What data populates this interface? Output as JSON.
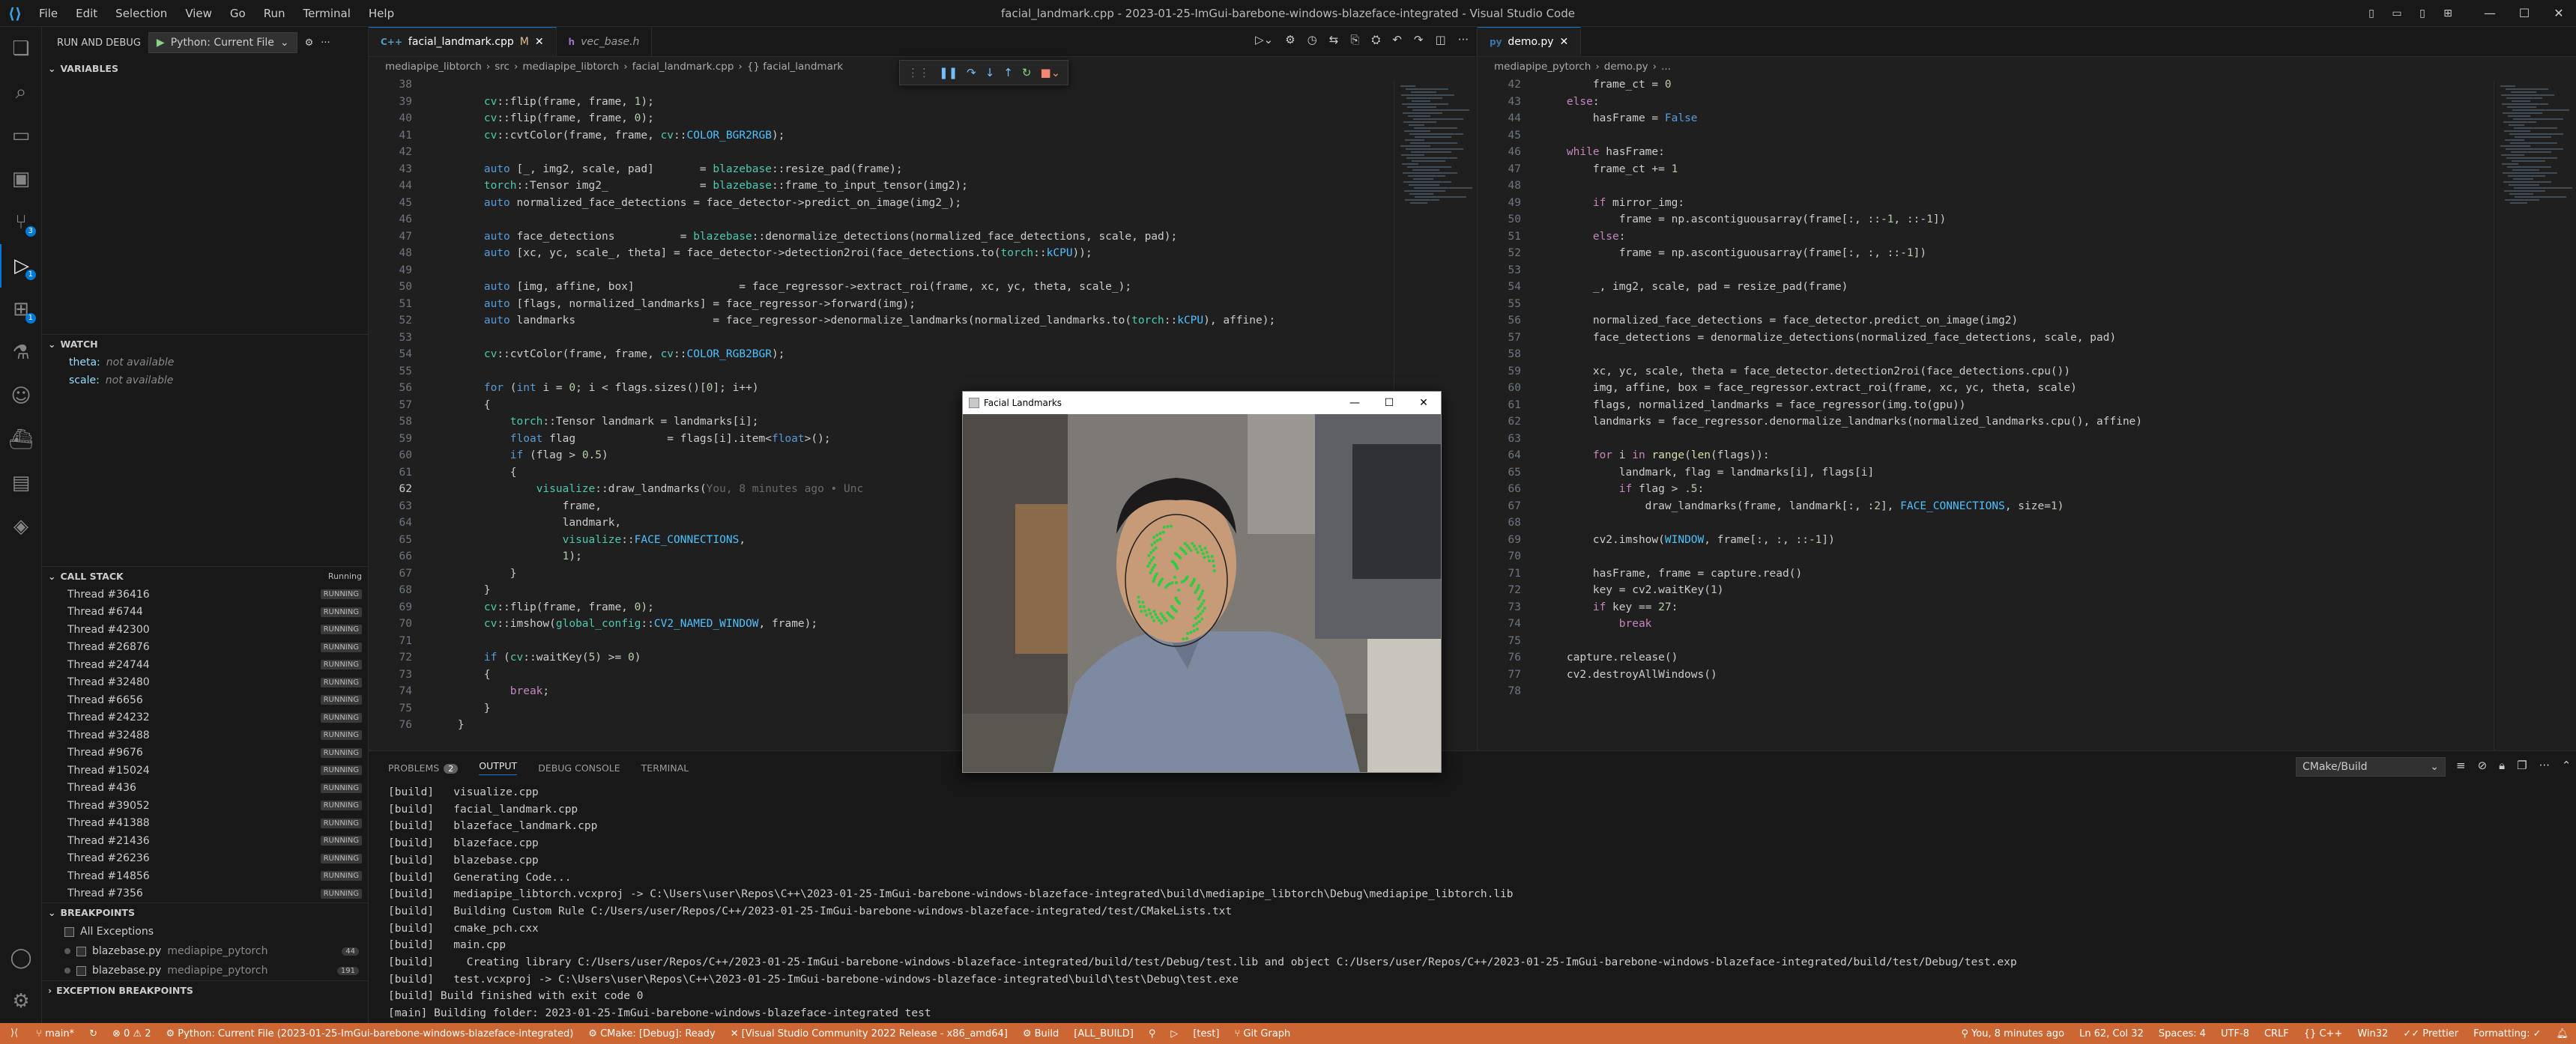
{
  "titlebar": {
    "menu": [
      "File",
      "Edit",
      "Selection",
      "View",
      "Go",
      "Run",
      "Terminal",
      "Help"
    ],
    "title": "facial_landmark.cpp - 2023-01-25-ImGui-barebone-windows-blazeface-integrated - Visual Studio Code"
  },
  "activity": {
    "badges": {
      "scm": "3",
      "debug": "1",
      "ext": "1"
    }
  },
  "sidebar": {
    "run_label": "RUN AND DEBUG",
    "config": "Python: Current File",
    "variables": "VARIABLES",
    "watch": "WATCH",
    "watch_items": [
      {
        "name": "theta:",
        "value": "not available"
      },
      {
        "name": "scale:",
        "value": "not available"
      }
    ],
    "call_stack": "CALL STACK",
    "call_stack_status": "Running",
    "threads": [
      "Thread #36416",
      "Thread #6744",
      "Thread #42300",
      "Thread #26876",
      "Thread #24744",
      "Thread #32480",
      "Thread #6656",
      "Thread #24232",
      "Thread #32488",
      "Thread #9676",
      "Thread #15024",
      "Thread #436",
      "Thread #39052",
      "Thread #41388",
      "Thread #21436",
      "Thread #26236",
      "Thread #14856",
      "Thread #7356"
    ],
    "running": "RUNNING",
    "breakpoints": "BREAKPOINTS",
    "bp_items": [
      {
        "label": "All Exceptions",
        "path": "",
        "count": ""
      },
      {
        "label": "blazebase.py",
        "path": "mediapipe_pytorch",
        "count": "44"
      },
      {
        "label": "blazebase.py",
        "path": "mediapipe_pytorch",
        "count": "191"
      }
    ],
    "exception_bp": "EXCEPTION BREAKPOINTS"
  },
  "editor1": {
    "tabs": [
      {
        "label": "facial_landmark.cpp",
        "mod": "M",
        "icon": "C++"
      },
      {
        "label": "vec_base.h",
        "mod": "",
        "icon": "h"
      }
    ],
    "breadcrumb": [
      "mediapipe_libtorch",
      "src",
      "mediapipe_libtorch",
      "facial_landmark.cpp",
      "{} facial_landmark"
    ],
    "ghost_text": "You, 8 minutes ago • Unc",
    "lines": [
      {
        "n": "38",
        "t": ""
      },
      {
        "n": "39",
        "t": "        cv::flip(frame, frame, 1);"
      },
      {
        "n": "40",
        "t": "        cv::flip(frame, frame, 0);"
      },
      {
        "n": "41",
        "t": "        cv::cvtColor(frame, frame, cv::COLOR_BGR2RGB);"
      },
      {
        "n": "42",
        "t": ""
      },
      {
        "n": "43",
        "t": "        auto [_, img2, scale, pad]       = blazebase::resize_pad(frame);"
      },
      {
        "n": "44",
        "t": "        torch::Tensor img2_              = blazebase::frame_to_input_tensor(img2);"
      },
      {
        "n": "45",
        "t": "        auto normalized_face_detections = face_detector->predict_on_image(img2_);"
      },
      {
        "n": "46",
        "t": ""
      },
      {
        "n": "47",
        "t": "        auto face_detections          = blazebase::denormalize_detections(normalized_face_detections, scale, pad);"
      },
      {
        "n": "48",
        "t": "        auto [xc, yc, scale_, theta] = face_detector->detection2roi(face_detections.to(torch::kCPU));"
      },
      {
        "n": "49",
        "t": ""
      },
      {
        "n": "50",
        "t": "        auto [img, affine, box]                = face_regressor->extract_roi(frame, xc, yc, theta, scale_);"
      },
      {
        "n": "51",
        "t": "        auto [flags, normalized_landmarks] = face_regressor->forward(img);"
      },
      {
        "n": "52",
        "t": "        auto landmarks                     = face_regressor->denormalize_landmarks(normalized_landmarks.to(torch::kCPU), affine);"
      },
      {
        "n": "53",
        "t": ""
      },
      {
        "n": "54",
        "t": "        cv::cvtColor(frame, frame, cv::COLOR_RGB2BGR);"
      },
      {
        "n": "55",
        "t": ""
      },
      {
        "n": "56",
        "t": "        for (int i = 0; i < flags.sizes()[0]; i++)"
      },
      {
        "n": "57",
        "t": "        {"
      },
      {
        "n": "58",
        "t": "            torch::Tensor landmark = landmarks[i];"
      },
      {
        "n": "59",
        "t": "            float flag              = flags[i].item<float>();"
      },
      {
        "n": "60",
        "t": "            if (flag > 0.5)"
      },
      {
        "n": "61",
        "t": "            {"
      },
      {
        "n": "62",
        "t": "                visualize::draw_landmarks("
      },
      {
        "n": "63",
        "t": "                    frame,"
      },
      {
        "n": "64",
        "t": "                    landmark,"
      },
      {
        "n": "65",
        "t": "                    visualize::FACE_CONNECTIONS,"
      },
      {
        "n": "66",
        "t": "                    1);"
      },
      {
        "n": "67",
        "t": "            }"
      },
      {
        "n": "68",
        "t": "        }"
      },
      {
        "n": "69",
        "t": "        cv::flip(frame, frame, 0);"
      },
      {
        "n": "70",
        "t": "        cv::imshow(global_config::CV2_NAMED_WINDOW, frame);"
      },
      {
        "n": "71",
        "t": ""
      },
      {
        "n": "72",
        "t": "        if (cv::waitKey(5) >= 0)"
      },
      {
        "n": "73",
        "t": "        {"
      },
      {
        "n": "74",
        "t": "            break;"
      },
      {
        "n": "75",
        "t": "        }"
      },
      {
        "n": "76",
        "t": "    }"
      }
    ]
  },
  "editor2": {
    "tabs": [
      {
        "label": "demo.py",
        "icon": "py"
      }
    ],
    "breadcrumb": [
      "mediapipe_pytorch",
      "demo.py",
      "..."
    ],
    "lines": [
      {
        "n": "42",
        "t": "        frame_ct = 0"
      },
      {
        "n": "43",
        "t": "    else:"
      },
      {
        "n": "44",
        "t": "        hasFrame = False"
      },
      {
        "n": "45",
        "t": ""
      },
      {
        "n": "46",
        "t": "    while hasFrame:"
      },
      {
        "n": "47",
        "t": "        frame_ct += 1"
      },
      {
        "n": "48",
        "t": ""
      },
      {
        "n": "49",
        "t": "        if mirror_img:"
      },
      {
        "n": "50",
        "t": "            frame = np.ascontiguousarray(frame[:, ::-1, ::-1])"
      },
      {
        "n": "51",
        "t": "        else:"
      },
      {
        "n": "52",
        "t": "            frame = np.ascontiguousarray(frame[:, :, ::-1])"
      },
      {
        "n": "53",
        "t": ""
      },
      {
        "n": "54",
        "t": "        _, img2, scale, pad = resize_pad(frame)"
      },
      {
        "n": "55",
        "t": ""
      },
      {
        "n": "56",
        "t": "        normalized_face_detections = face_detector.predict_on_image(img2)"
      },
      {
        "n": "57",
        "t": "        face_detections = denormalize_detections(normalized_face_detections, scale, pad)"
      },
      {
        "n": "58",
        "t": ""
      },
      {
        "n": "59",
        "t": "        xc, yc, scale, theta = face_detector.detection2roi(face_detections.cpu())"
      },
      {
        "n": "60",
        "t": "        img, affine, box = face_regressor.extract_roi(frame, xc, yc, theta, scale)"
      },
      {
        "n": "61",
        "t": "        flags, normalized_landmarks = face_regressor(img.to(gpu))"
      },
      {
        "n": "62",
        "t": "        landmarks = face_regressor.denormalize_landmarks(normalized_landmarks.cpu(), affine)"
      },
      {
        "n": "63",
        "t": ""
      },
      {
        "n": "64",
        "t": "        for i in range(len(flags)):"
      },
      {
        "n": "65",
        "t": "            landmark, flag = landmarks[i], flags[i]"
      },
      {
        "n": "66",
        "t": "            if flag > .5:"
      },
      {
        "n": "67",
        "t": "                draw_landmarks(frame, landmark[:, :2], FACE_CONNECTIONS, size=1)"
      },
      {
        "n": "68",
        "t": ""
      },
      {
        "n": "69",
        "t": "        cv2.imshow(WINDOW, frame[:, :, ::-1])"
      },
      {
        "n": "70",
        "t": ""
      },
      {
        "n": "71",
        "t": "        hasFrame, frame = capture.read()"
      },
      {
        "n": "72",
        "t": "        key = cv2.waitKey(1)"
      },
      {
        "n": "73",
        "t": "        if key == 27:"
      },
      {
        "n": "74",
        "t": "            break"
      },
      {
        "n": "75",
        "t": ""
      },
      {
        "n": "76",
        "t": "    capture.release()"
      },
      {
        "n": "77",
        "t": "    cv2.destroyAllWindows()"
      },
      {
        "n": "78",
        "t": ""
      }
    ]
  },
  "panel": {
    "tabs": [
      "PROBLEMS",
      "OUTPUT",
      "DEBUG CONSOLE",
      "TERMINAL"
    ],
    "problems_count": "2",
    "select": "CMake/Build",
    "output": [
      "[build]   visualize.cpp",
      "[build]   facial_landmark.cpp",
      "[build]   blazeface_landmark.cpp",
      "[build]   blazeface.cpp",
      "[build]   blazebase.cpp",
      "[build]   Generating Code...",
      "[build]   mediapipe_libtorch.vcxproj -> C:\\Users\\user\\Repos\\C++\\2023-01-25-ImGui-barebone-windows-blazeface-integrated\\build\\mediapipe_libtorch\\Debug\\mediapipe_libtorch.lib",
      "[build]   Building Custom Rule C:/Users/user/Repos/C++/2023-01-25-ImGui-barebone-windows-blazeface-integrated/test/CMakeLists.txt",
      "[build]   cmake_pch.cxx",
      "[build]   main.cpp",
      "[build]     Creating library C:/Users/user/Repos/C++/2023-01-25-ImGui-barebone-windows-blazeface-integrated/build/test/Debug/test.lib and object C:/Users/user/Repos/C++/2023-01-25-ImGui-barebone-windows-blazeface-integrated/build/test/Debug/test.exp",
      "[build]   test.vcxproj -> C:\\Users\\user\\Repos\\C++\\2023-01-25-ImGui-barebone-windows-blazeface-integrated\\build\\test\\Debug\\test.exe",
      "[build] Build finished with exit code 0",
      "[main] Building folder: 2023-01-25-ImGui-barebone-windows-blazeface-integrated test"
    ]
  },
  "facewin": {
    "title": "Facial Landmarks"
  },
  "statusbar": {
    "left": [
      "main*",
      "⊗ 0 ⚠ 2",
      "Python: Current File (2023-01-25-ImGui-barebone-windows-blazeface-integrated)",
      "CMake: [Debug]: Ready",
      "[Visual Studio Community 2022 Release - x86_amd64]",
      "Build",
      "[ALL_BUILD]",
      "[test]",
      "Git Graph"
    ],
    "right": [
      "You, 8 minutes ago",
      "Ln 62, Col 32",
      "Spaces: 4",
      "UTF-8",
      "CRLF",
      "C++",
      "Win32",
      "Prettier",
      "Formatting: ✓"
    ]
  },
  "colors": {
    "accent": "#0078d4",
    "statusbar": "#cc6633",
    "landmark": "#2ecc40"
  }
}
